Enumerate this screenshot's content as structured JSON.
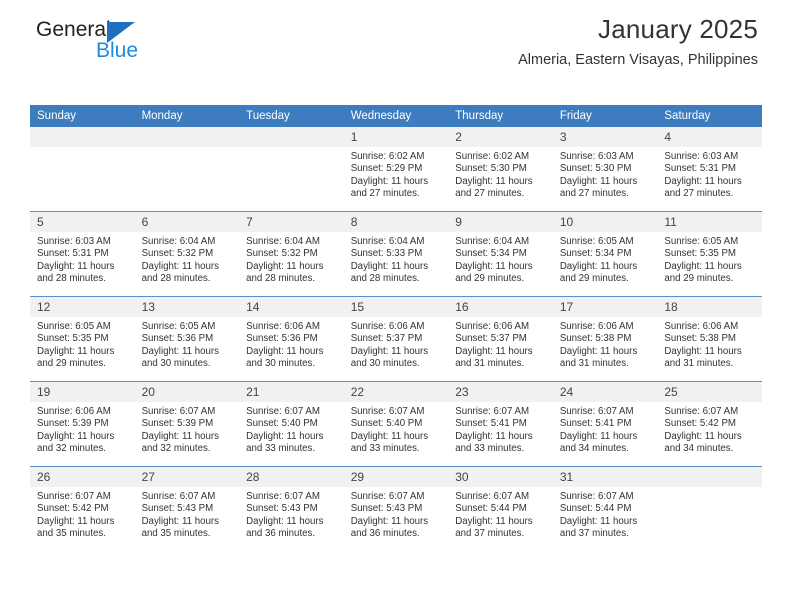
{
  "brand": {
    "name_part1": "General",
    "name_part2": "Blue",
    "triangle_icon": "blue-triangle-logo-mark",
    "accent_blue": "#1f8ae0",
    "logo_blue": "#1f6fc0"
  },
  "header": {
    "title": "January 2025",
    "subtitle": "Almeria, Eastern Visayas, Philippines"
  },
  "theme": {
    "header_row_bg": "#3c7cbf",
    "daynum_bg": "#f1f1f1",
    "row_divider": "#5b90c9",
    "text": "#333333"
  },
  "calendar": {
    "weekday_headers": [
      "Sunday",
      "Monday",
      "Tuesday",
      "Wednesday",
      "Thursday",
      "Friday",
      "Saturday"
    ],
    "weeks": [
      [
        {
          "day": "",
          "empty": true,
          "sunrise": "",
          "sunset": "",
          "daylight_1": "",
          "daylight_2": ""
        },
        {
          "day": "",
          "empty": true,
          "sunrise": "",
          "sunset": "",
          "daylight_1": "",
          "daylight_2": ""
        },
        {
          "day": "",
          "empty": true,
          "sunrise": "",
          "sunset": "",
          "daylight_1": "",
          "daylight_2": ""
        },
        {
          "day": "1",
          "empty": false,
          "sunrise": "Sunrise: 6:02 AM",
          "sunset": "Sunset: 5:29 PM",
          "daylight_1": "Daylight: 11 hours",
          "daylight_2": "and 27 minutes."
        },
        {
          "day": "2",
          "empty": false,
          "sunrise": "Sunrise: 6:02 AM",
          "sunset": "Sunset: 5:30 PM",
          "daylight_1": "Daylight: 11 hours",
          "daylight_2": "and 27 minutes."
        },
        {
          "day": "3",
          "empty": false,
          "sunrise": "Sunrise: 6:03 AM",
          "sunset": "Sunset: 5:30 PM",
          "daylight_1": "Daylight: 11 hours",
          "daylight_2": "and 27 minutes."
        },
        {
          "day": "4",
          "empty": false,
          "sunrise": "Sunrise: 6:03 AM",
          "sunset": "Sunset: 5:31 PM",
          "daylight_1": "Daylight: 11 hours",
          "daylight_2": "and 27 minutes."
        }
      ],
      [
        {
          "day": "5",
          "empty": false,
          "sunrise": "Sunrise: 6:03 AM",
          "sunset": "Sunset: 5:31 PM",
          "daylight_1": "Daylight: 11 hours",
          "daylight_2": "and 28 minutes."
        },
        {
          "day": "6",
          "empty": false,
          "sunrise": "Sunrise: 6:04 AM",
          "sunset": "Sunset: 5:32 PM",
          "daylight_1": "Daylight: 11 hours",
          "daylight_2": "and 28 minutes."
        },
        {
          "day": "7",
          "empty": false,
          "sunrise": "Sunrise: 6:04 AM",
          "sunset": "Sunset: 5:32 PM",
          "daylight_1": "Daylight: 11 hours",
          "daylight_2": "and 28 minutes."
        },
        {
          "day": "8",
          "empty": false,
          "sunrise": "Sunrise: 6:04 AM",
          "sunset": "Sunset: 5:33 PM",
          "daylight_1": "Daylight: 11 hours",
          "daylight_2": "and 28 minutes."
        },
        {
          "day": "9",
          "empty": false,
          "sunrise": "Sunrise: 6:04 AM",
          "sunset": "Sunset: 5:34 PM",
          "daylight_1": "Daylight: 11 hours",
          "daylight_2": "and 29 minutes."
        },
        {
          "day": "10",
          "empty": false,
          "sunrise": "Sunrise: 6:05 AM",
          "sunset": "Sunset: 5:34 PM",
          "daylight_1": "Daylight: 11 hours",
          "daylight_2": "and 29 minutes."
        },
        {
          "day": "11",
          "empty": false,
          "sunrise": "Sunrise: 6:05 AM",
          "sunset": "Sunset: 5:35 PM",
          "daylight_1": "Daylight: 11 hours",
          "daylight_2": "and 29 minutes."
        }
      ],
      [
        {
          "day": "12",
          "empty": false,
          "sunrise": "Sunrise: 6:05 AM",
          "sunset": "Sunset: 5:35 PM",
          "daylight_1": "Daylight: 11 hours",
          "daylight_2": "and 29 minutes."
        },
        {
          "day": "13",
          "empty": false,
          "sunrise": "Sunrise: 6:05 AM",
          "sunset": "Sunset: 5:36 PM",
          "daylight_1": "Daylight: 11 hours",
          "daylight_2": "and 30 minutes."
        },
        {
          "day": "14",
          "empty": false,
          "sunrise": "Sunrise: 6:06 AM",
          "sunset": "Sunset: 5:36 PM",
          "daylight_1": "Daylight: 11 hours",
          "daylight_2": "and 30 minutes."
        },
        {
          "day": "15",
          "empty": false,
          "sunrise": "Sunrise: 6:06 AM",
          "sunset": "Sunset: 5:37 PM",
          "daylight_1": "Daylight: 11 hours",
          "daylight_2": "and 30 minutes."
        },
        {
          "day": "16",
          "empty": false,
          "sunrise": "Sunrise: 6:06 AM",
          "sunset": "Sunset: 5:37 PM",
          "daylight_1": "Daylight: 11 hours",
          "daylight_2": "and 31 minutes."
        },
        {
          "day": "17",
          "empty": false,
          "sunrise": "Sunrise: 6:06 AM",
          "sunset": "Sunset: 5:38 PM",
          "daylight_1": "Daylight: 11 hours",
          "daylight_2": "and 31 minutes."
        },
        {
          "day": "18",
          "empty": false,
          "sunrise": "Sunrise: 6:06 AM",
          "sunset": "Sunset: 5:38 PM",
          "daylight_1": "Daylight: 11 hours",
          "daylight_2": "and 31 minutes."
        }
      ],
      [
        {
          "day": "19",
          "empty": false,
          "sunrise": "Sunrise: 6:06 AM",
          "sunset": "Sunset: 5:39 PM",
          "daylight_1": "Daylight: 11 hours",
          "daylight_2": "and 32 minutes."
        },
        {
          "day": "20",
          "empty": false,
          "sunrise": "Sunrise: 6:07 AM",
          "sunset": "Sunset: 5:39 PM",
          "daylight_1": "Daylight: 11 hours",
          "daylight_2": "and 32 minutes."
        },
        {
          "day": "21",
          "empty": false,
          "sunrise": "Sunrise: 6:07 AM",
          "sunset": "Sunset: 5:40 PM",
          "daylight_1": "Daylight: 11 hours",
          "daylight_2": "and 33 minutes."
        },
        {
          "day": "22",
          "empty": false,
          "sunrise": "Sunrise: 6:07 AM",
          "sunset": "Sunset: 5:40 PM",
          "daylight_1": "Daylight: 11 hours",
          "daylight_2": "and 33 minutes."
        },
        {
          "day": "23",
          "empty": false,
          "sunrise": "Sunrise: 6:07 AM",
          "sunset": "Sunset: 5:41 PM",
          "daylight_1": "Daylight: 11 hours",
          "daylight_2": "and 33 minutes."
        },
        {
          "day": "24",
          "empty": false,
          "sunrise": "Sunrise: 6:07 AM",
          "sunset": "Sunset: 5:41 PM",
          "daylight_1": "Daylight: 11 hours",
          "daylight_2": "and 34 minutes."
        },
        {
          "day": "25",
          "empty": false,
          "sunrise": "Sunrise: 6:07 AM",
          "sunset": "Sunset: 5:42 PM",
          "daylight_1": "Daylight: 11 hours",
          "daylight_2": "and 34 minutes."
        }
      ],
      [
        {
          "day": "26",
          "empty": false,
          "sunrise": "Sunrise: 6:07 AM",
          "sunset": "Sunset: 5:42 PM",
          "daylight_1": "Daylight: 11 hours",
          "daylight_2": "and 35 minutes."
        },
        {
          "day": "27",
          "empty": false,
          "sunrise": "Sunrise: 6:07 AM",
          "sunset": "Sunset: 5:43 PM",
          "daylight_1": "Daylight: 11 hours",
          "daylight_2": "and 35 minutes."
        },
        {
          "day": "28",
          "empty": false,
          "sunrise": "Sunrise: 6:07 AM",
          "sunset": "Sunset: 5:43 PM",
          "daylight_1": "Daylight: 11 hours",
          "daylight_2": "and 36 minutes."
        },
        {
          "day": "29",
          "empty": false,
          "sunrise": "Sunrise: 6:07 AM",
          "sunset": "Sunset: 5:43 PM",
          "daylight_1": "Daylight: 11 hours",
          "daylight_2": "and 36 minutes."
        },
        {
          "day": "30",
          "empty": false,
          "sunrise": "Sunrise: 6:07 AM",
          "sunset": "Sunset: 5:44 PM",
          "daylight_1": "Daylight: 11 hours",
          "daylight_2": "and 37 minutes."
        },
        {
          "day": "31",
          "empty": false,
          "sunrise": "Sunrise: 6:07 AM",
          "sunset": "Sunset: 5:44 PM",
          "daylight_1": "Daylight: 11 hours",
          "daylight_2": "and 37 minutes."
        },
        {
          "day": "",
          "empty": true,
          "sunrise": "",
          "sunset": "",
          "daylight_1": "",
          "daylight_2": ""
        }
      ]
    ]
  }
}
